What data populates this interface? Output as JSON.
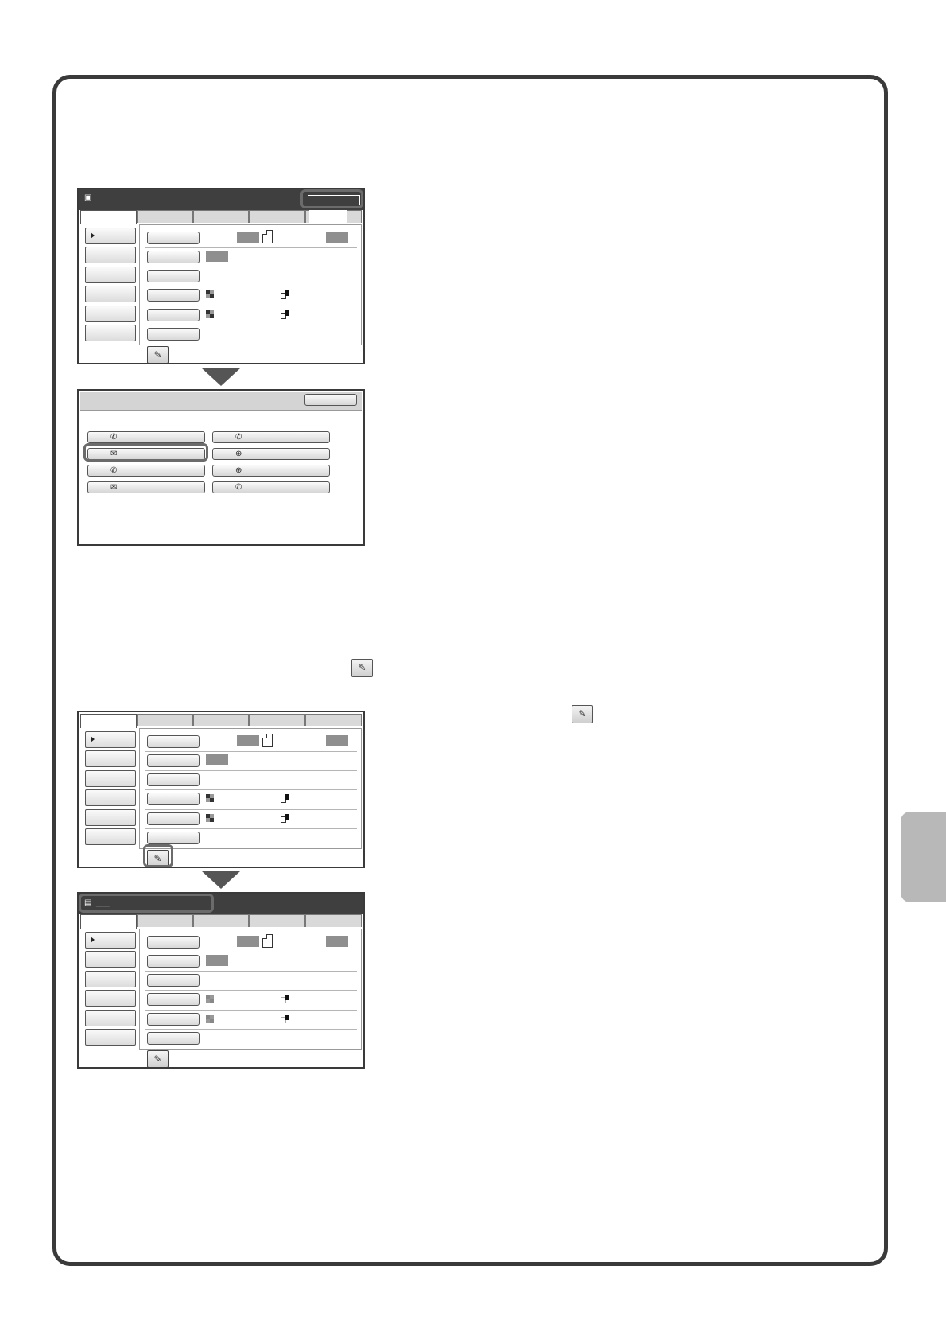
{
  "icons": {
    "memo_glyph": "✎",
    "phone_glyph": "✆",
    "mail_glyph": "✉",
    "globe_glyph": "⊕",
    "doc_glyph": "▤",
    "fax_glyph": "▣"
  },
  "screen4": {
    "title_text": "___"
  },
  "colors": {
    "frame": "#3a3a3a",
    "side_tab": "#b8b8b8",
    "title_bar": "#3f3f3f"
  }
}
